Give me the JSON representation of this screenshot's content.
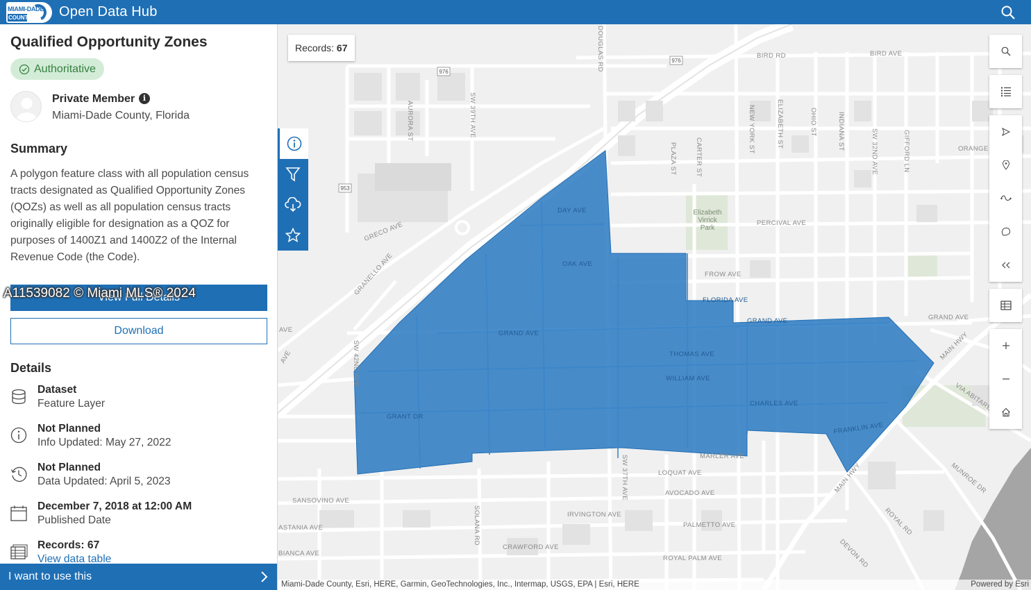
{
  "header": {
    "logo_top": "MIAMI-DADE",
    "logo_bottom": "COUNTY",
    "title": "Open Data Hub",
    "search_icon": "search-icon"
  },
  "dataset": {
    "title": "Qualified Opportunity Zones",
    "badge": "Authoritative",
    "owner_name": "Private Member",
    "owner_org": "Miami-Dade County, Florida",
    "summary_heading": "Summary",
    "summary": "A polygon feature class with all population census tracts designated as Qualified Opportunity Zones (QOZs) as well as all population census tracts originally eligible for designation as a QOZ for purposes of 1400Z1 and 1400Z2 of the Internal Revenue Code (the Code).",
    "view_button": "View Full Details",
    "download_button": "Download",
    "watermark": "A11539082 © Miami MLS® 2024",
    "details_heading": "Details",
    "details": [
      {
        "icon": "database-icon",
        "title": "Dataset",
        "sub": "Feature Layer"
      },
      {
        "icon": "info-icon",
        "title": "Not Planned",
        "sub": "Info Updated: May 27, 2022"
      },
      {
        "icon": "history-icon",
        "title": "Not Planned",
        "sub": "Data Updated: April 5, 2023"
      },
      {
        "icon": "calendar-icon",
        "title": "December 7, 2018 at 12:00 AM",
        "sub": "Published Date"
      },
      {
        "icon": "table-icon",
        "title": "Records: 67",
        "link": "View data table"
      }
    ],
    "bottom_bar": "I want to use this"
  },
  "map": {
    "records_label": "Records:",
    "records_value": "67",
    "zone_color": "#2a79c2",
    "attribution": "Miami-Dade County, Esri, HERE, Garmin, GeoTechnologies, Inc., Intermap, USGS, EPA | Esri, HERE",
    "powered_by": "Powered by Esri",
    "left_tools": [
      "info-icon",
      "filter-icon",
      "cloud-download-icon",
      "star-icon"
    ],
    "right_tools": [
      "search-icon",
      "legend-icon",
      "navigate-icon",
      "pin-icon",
      "measure-icon",
      "lasso-icon",
      "collapse-icon",
      "table-icon",
      "zoom-in-icon",
      "zoom-out-icon",
      "home-icon"
    ],
    "streets": [
      "BIRD RD",
      "BIRD AVE",
      "AURORA ST",
      "SW 39TH AVE",
      "DAY AVE",
      "OAK AVE",
      "GRECO AVE",
      "GRANELLO AVE",
      "GRAND AVE",
      "THOMAS AVE",
      "WILLIAM AVE",
      "CHARLES AVE",
      "FRANKLIN AVE",
      "GRANT DR",
      "MARLER AVE",
      "LOQUAT AVE",
      "AVOCADO AVE",
      "IRVINGTON AVE",
      "PALMETTO AVE",
      "CRAWFORD AVE",
      "ROYAL PALM AVE",
      "SANSOVINO AVE",
      "ASTANIA AVE",
      "BIANCA AVE",
      "SOLANA RD",
      "SW 37TH AVE",
      "SW 42ND AVE",
      "PERCIVAL AVE",
      "FROW AVE",
      "FLORIDA AVE",
      "PLAZA ST",
      "CARTER ST",
      "NEW YORK ST",
      "ELIZABETH ST",
      "OHIO ST",
      "INDIANA ST",
      "SW 32ND AVE",
      "GIFFORD LN",
      "ORANGE ST",
      "MAIN HWY",
      "VIA ABITARE",
      "MUNROE DR",
      "ROYAL RD",
      "DEVON RD",
      "AVE",
      "DOUGLAS RD",
      "976",
      "953"
    ],
    "park": "Elizabeth Virrick Park"
  }
}
